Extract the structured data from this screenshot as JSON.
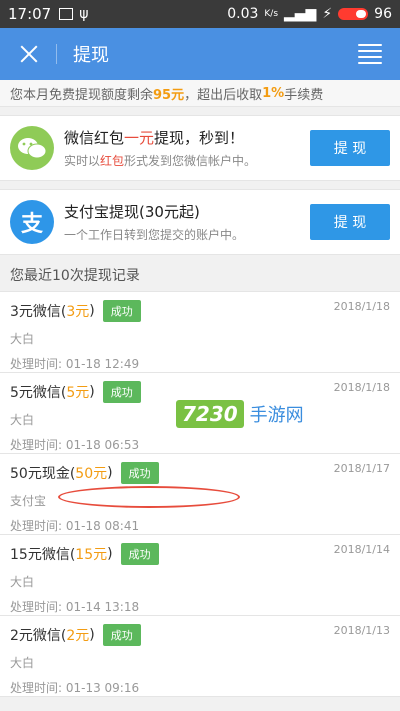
{
  "status_bar": {
    "time": "17:07",
    "network": "0.03",
    "network_unit": "K/s",
    "battery": "96"
  },
  "nav": {
    "title": "提现"
  },
  "notice": {
    "prefix": "您本月免费提现额度剩余",
    "amount": "95元",
    "middle": "，超出后收取",
    "rate": "1%",
    "suffix": "手续费"
  },
  "wechat": {
    "title_a": "微信红包",
    "title_red": "一元",
    "title_b": "提现，秒到！",
    "sub_a": "实时以",
    "sub_red": "红包",
    "sub_b": "形式发到您微信帐户中。",
    "button": "提 现"
  },
  "alipay": {
    "title": "支付宝提现(30元起)",
    "sub": "一个工作日转到您提交的账户中。",
    "button": "提 现"
  },
  "history_title": "您最近10次提现记录",
  "records": [
    {
      "prefix": "3元微信(",
      "amount": "3元",
      "suffix": ")",
      "status": "成功",
      "date": "2018/1/18",
      "account": "大白",
      "time": "处理时间: 01-18 12:49"
    },
    {
      "prefix": "5元微信(",
      "amount": "5元",
      "suffix": ")",
      "status": "成功",
      "date": "2018/1/18",
      "account": "大白",
      "time": "处理时间: 01-18 06:53"
    },
    {
      "prefix": "50元现金(",
      "amount": "50元",
      "suffix": ")",
      "status": "成功",
      "date": "2018/1/17",
      "account": "支付宝",
      "time": "处理时间: 01-18 08:41"
    },
    {
      "prefix": "15元微信(",
      "amount": "15元",
      "suffix": ")",
      "status": "成功",
      "date": "2018/1/14",
      "account": "大白",
      "time": "处理时间: 01-14 13:18"
    },
    {
      "prefix": "2元微信(",
      "amount": "2元",
      "suffix": ")",
      "status": "成功",
      "date": "2018/1/13",
      "account": "大白",
      "time": "处理时间: 01-13 09:16"
    }
  ],
  "watermark": {
    "logo": "7230",
    "text": "手游网"
  },
  "colors": {
    "primary": "#4a90e2",
    "button": "#2f97e6",
    "success": "#5cb85c",
    "highlight": "#f39c12",
    "red": "#e74c3c"
  }
}
